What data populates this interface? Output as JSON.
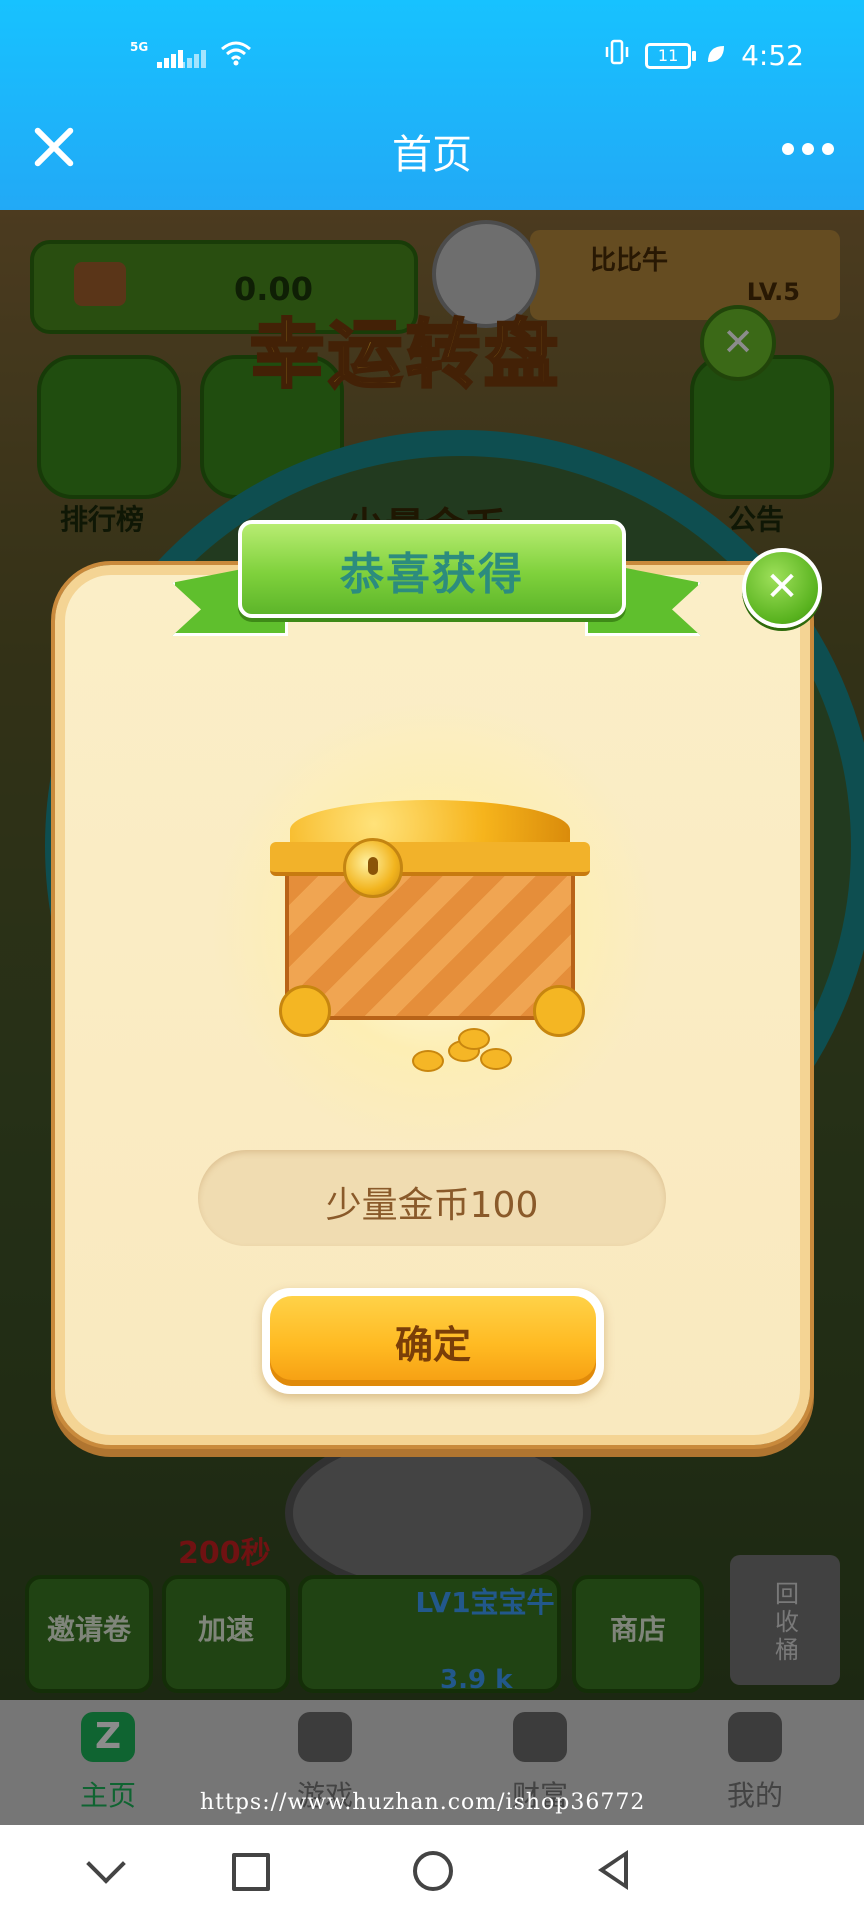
{
  "status_bar": {
    "network_1": "5G",
    "time": "4:52",
    "battery": "11"
  },
  "header": {
    "title": "首页"
  },
  "game": {
    "coin_value": "0.00",
    "player_name": "比比牛",
    "player_level": "LV.5",
    "wheel_title": "幸运转盘",
    "wheel_segment_label": "少量金币",
    "menu_left": "排行榜",
    "menu_right": "公告",
    "timer": "200秒",
    "buttons": [
      "邀请卷",
      "加速",
      "商店"
    ],
    "pet_name": "LV1宝宝牛",
    "pet_value": "3.9 k",
    "bin_label": "回收桶"
  },
  "modal": {
    "title": "恭喜获得",
    "reward": "少量金币100",
    "confirm": "确定",
    "close_glyph": "✕"
  },
  "tabs": [
    {
      "label": "主页",
      "icon": "home-icon",
      "glyph": "Z",
      "active": true
    },
    {
      "label": "游戏",
      "icon": "gamepad-icon",
      "active": false
    },
    {
      "label": "财富",
      "icon": "money-bag-icon",
      "active": false
    },
    {
      "label": "我的",
      "icon": "profile-icon",
      "active": false
    }
  ],
  "watermark": "https://www.huzhan.com/ishop36772",
  "colors": {
    "header_blue": "#22a9f6",
    "ribbon_green": "#7fd13c",
    "confirm_orange": "#ffba22",
    "active_tab": "#1db75a"
  }
}
